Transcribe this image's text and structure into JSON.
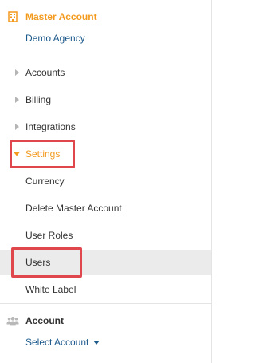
{
  "master": {
    "title": "Master Account",
    "agency": "Demo Agency",
    "icon": "building-icon",
    "color": "#f39a1e"
  },
  "nav": {
    "accounts": "Accounts",
    "billing": "Billing",
    "integrations": "Integrations",
    "settings": "Settings"
  },
  "settings_children": {
    "currency": "Currency",
    "delete_master": "Delete Master Account",
    "user_roles": "User Roles",
    "users": "Users",
    "white_label": "White Label"
  },
  "account": {
    "title": "Account",
    "icon": "users-group-icon",
    "select_label": "Select Account"
  },
  "colors": {
    "accent": "#f39a1e",
    "link": "#1d5a8c",
    "highlight_outline": "#e0474c",
    "selected_row": "#ebebeb"
  }
}
